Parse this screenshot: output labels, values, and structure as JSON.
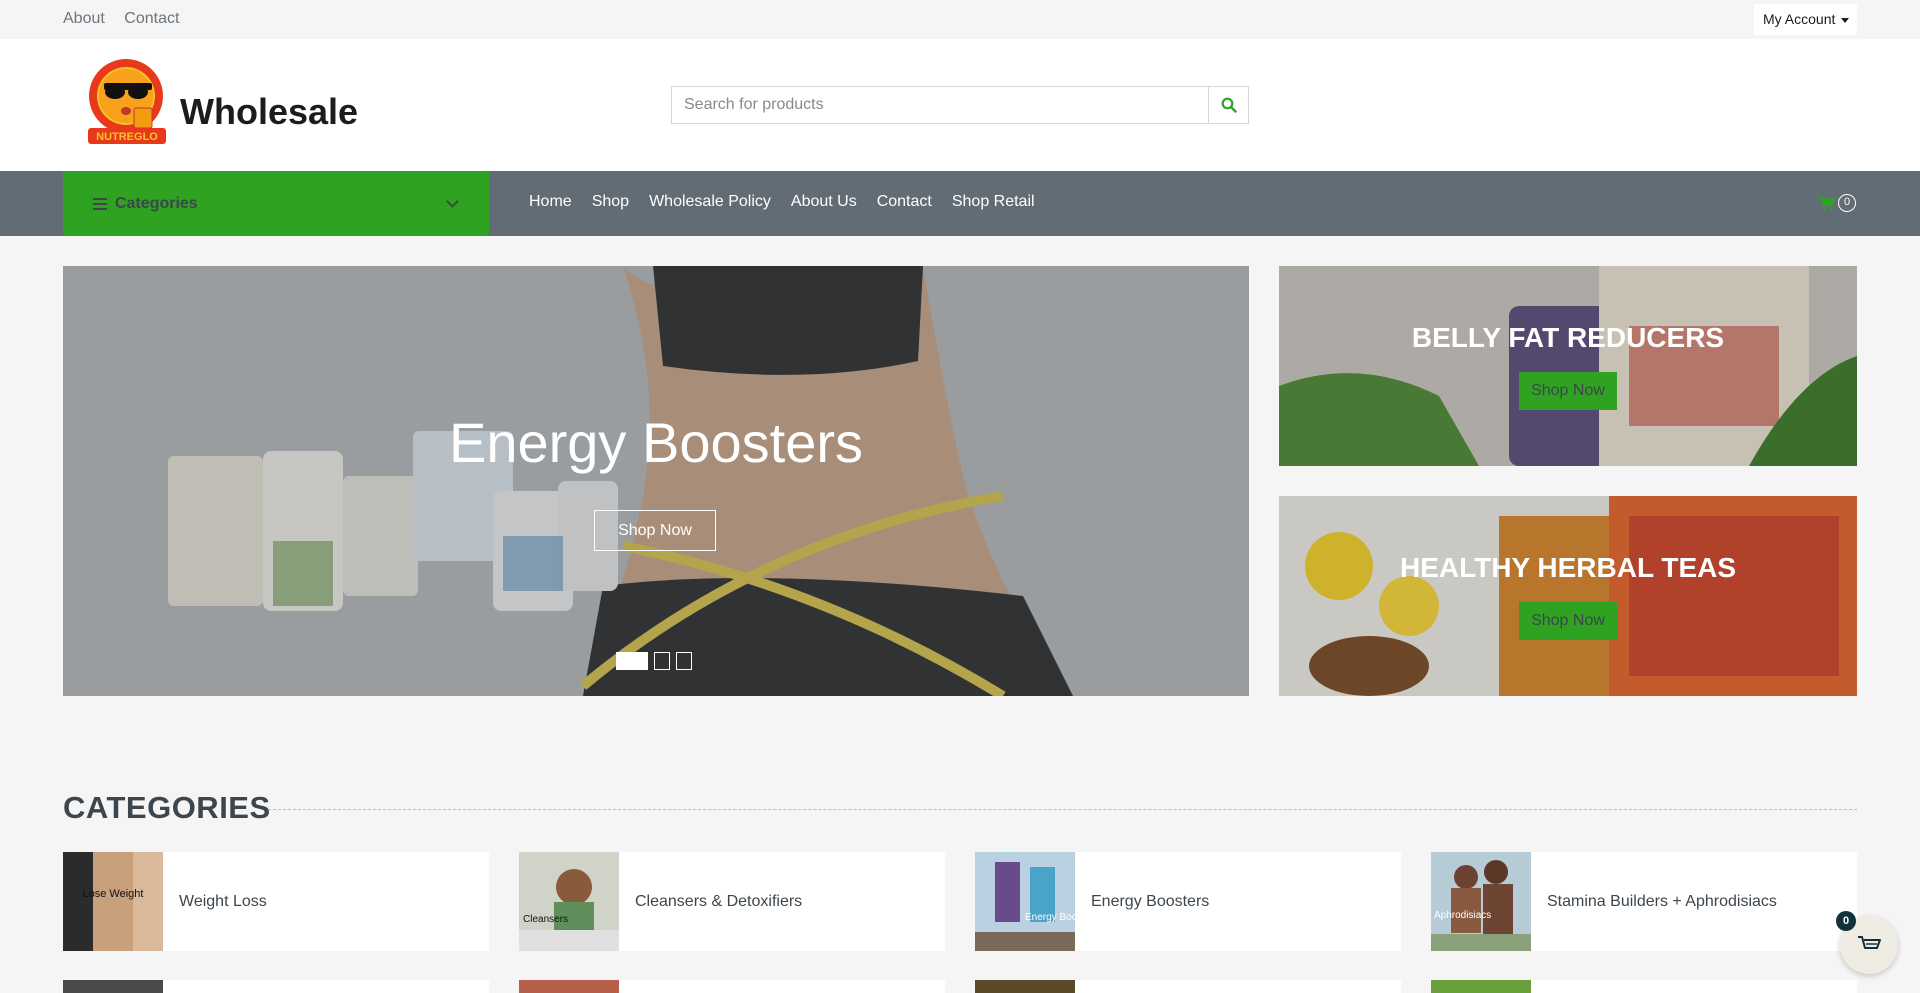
{
  "topbar": {
    "links": [
      "About",
      "Contact"
    ],
    "account_label": "My Account"
  },
  "header": {
    "logo_text": "NUTREGLO",
    "brand": "Wholesale",
    "search_placeholder": "Search for products"
  },
  "navbar": {
    "categories_label": "Categories",
    "menu": [
      "Home",
      "Shop",
      "Wholesale Policy",
      "About Us",
      "Contact",
      "Shop Retail"
    ],
    "cart_count": "0"
  },
  "hero": {
    "title": "Energy Boosters",
    "cta": "Shop Now",
    "slides": 3,
    "active_slide": 1
  },
  "promos": [
    {
      "title": "BELLY FAT REDUCERS",
      "cta": "Shop Now"
    },
    {
      "title": "HEALTHY HERBAL TEAS",
      "cta": "Shop Now"
    }
  ],
  "categories": {
    "title": "CATEGORIES",
    "items": [
      {
        "label": "Weight Loss",
        "thumb_text": "Lose Weight"
      },
      {
        "label": "Cleansers & Detoxifiers",
        "thumb_text": "Cleansers"
      },
      {
        "label": "Energy Boosters",
        "thumb_text": "Energy Boosters"
      },
      {
        "label": "Stamina Builders + Aphrodisiacs",
        "thumb_text": "Aphrodisiacs"
      }
    ]
  },
  "floating_cart": {
    "count": "0"
  },
  "colors": {
    "accent_green": "#2fa321",
    "nav_bg": "#616c75",
    "page_bg": "#f5f5f5",
    "text_dark": "#3d464d"
  },
  "icons": [
    "hamburger-icon",
    "chevron-down-icon",
    "search-icon",
    "cart-icon",
    "caret-down-icon"
  ]
}
